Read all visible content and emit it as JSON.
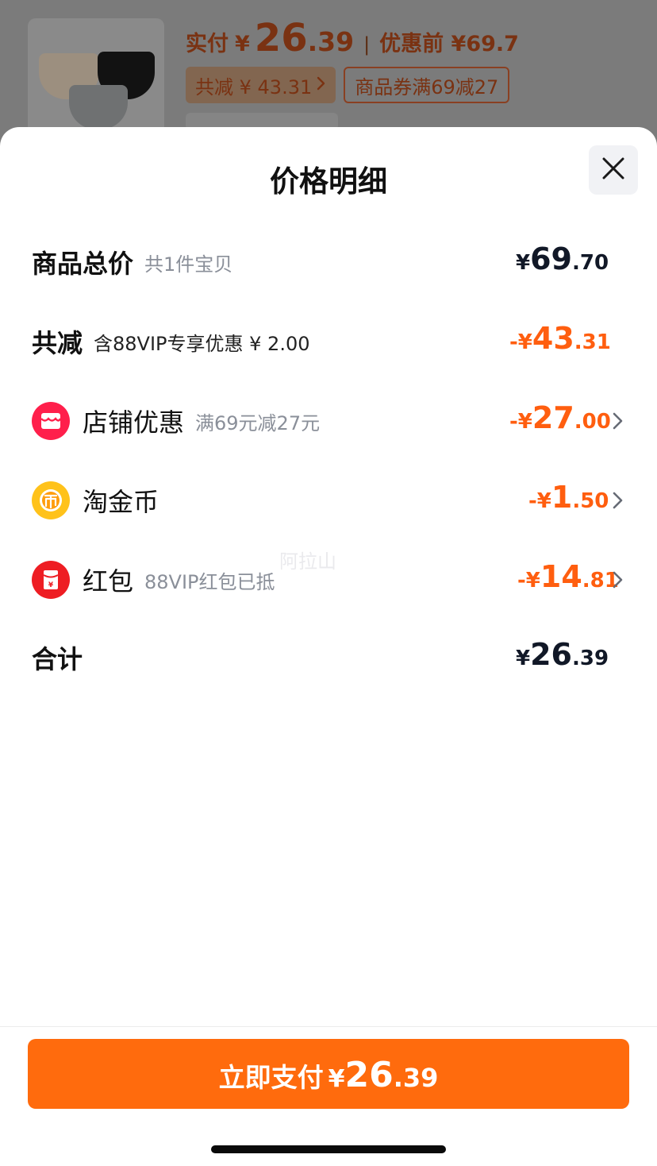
{
  "background": {
    "price_label": "实付",
    "price_yen": "¥",
    "price_int": "26",
    "price_dec": ".39",
    "separator": "|",
    "original_price": "优惠前 ¥69.7",
    "tags": [
      {
        "label": "共减 ¥ 43.31",
        "icon": "chevron-right-icon"
      },
      {
        "label": "商品券满69减27"
      }
    ]
  },
  "sheet": {
    "title": "价格明细",
    "close_icon": "close-icon"
  },
  "rows": {
    "subtotal": {
      "label": "商品总价",
      "sub": "共1件宝贝",
      "yen": "¥",
      "int": "69",
      "dec": ".70"
    },
    "total_discount": {
      "label": "共减",
      "sub": "含88VIP专享优惠 ¥ 2.00",
      "sign": "-",
      "yen": "¥",
      "int": "43",
      "dec": ".31"
    },
    "shop_discount": {
      "label": "店铺优惠",
      "sub": "满69元减27元",
      "sign": "-",
      "yen": "¥",
      "int": "27",
      "dec": ".00",
      "icon": "shop-icon",
      "icon_color": "#ff1f4b"
    },
    "taojinbi": {
      "label": "淘金币",
      "sign": "-",
      "yen": "¥",
      "int": "1",
      "dec": ".50",
      "icon": "coin-icon",
      "icon_color": "#ffc21a"
    },
    "red_packet": {
      "label": "红包",
      "sub": "88VIP红包已抵",
      "sign": "-",
      "yen": "¥",
      "int": "14",
      "dec": ".81",
      "icon": "red-packet-icon",
      "icon_color": "#ee1d23"
    },
    "total": {
      "label": "合计",
      "yen": "¥",
      "int": "26",
      "dec": ".39"
    }
  },
  "watermark": "阿拉山",
  "pay_button": {
    "label": "立即支付",
    "yen": "¥",
    "int": "26",
    "dec": ".39"
  },
  "colors": {
    "accent": "#ff6b0d",
    "discount": "#ff5e0f",
    "text": "#111111"
  }
}
